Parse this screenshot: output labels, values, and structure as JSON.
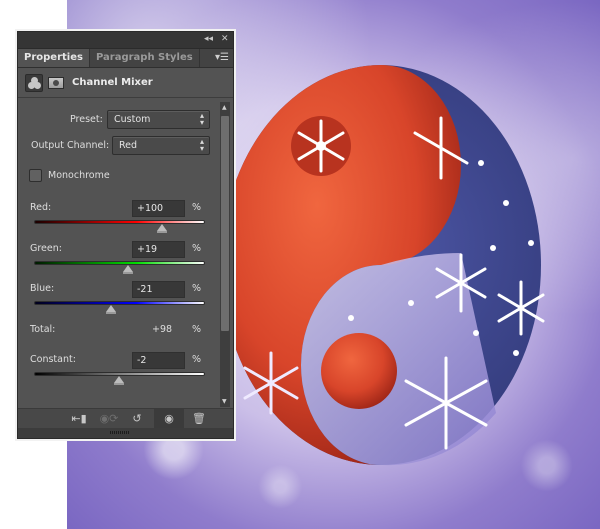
{
  "panel": {
    "topbar": {
      "collapse_icon": "double-chevron-left",
      "close_icon": "close-x"
    },
    "tabs": [
      {
        "label": "Properties",
        "active": true
      },
      {
        "label": "Paragraph Styles",
        "active": false
      }
    ],
    "menu_icon": "panel-menu",
    "adjustment": {
      "title": "Channel Mixer",
      "icons": [
        "channel-mixer-icon",
        "layer-mask-icon"
      ]
    },
    "preset": {
      "label": "Preset:",
      "value": "Custom"
    },
    "output_channel": {
      "label": "Output Channel:",
      "value": "Red"
    },
    "monochrome": {
      "label": "Monochrome",
      "checked": false
    },
    "channels": [
      {
        "label": "Red:",
        "value": "+100",
        "unit": "%",
        "percent": 100,
        "colors": [
          "#1a0000",
          "#ff0000",
          "#ffffff"
        ]
      },
      {
        "label": "Green:",
        "value": "+19",
        "unit": "%",
        "percent": 19,
        "colors": [
          "#001a00",
          "#00dd00",
          "#ffffff"
        ]
      },
      {
        "label": "Blue:",
        "value": "-21",
        "unit": "%",
        "percent": -21,
        "colors": [
          "#00001a",
          "#0000ff",
          "#ffffff"
        ]
      }
    ],
    "total": {
      "label": "Total:",
      "value": "+98",
      "unit": "%"
    },
    "constant": {
      "label": "Constant:",
      "value": "-2",
      "unit": "%",
      "percent": -2
    },
    "slider_range": [
      -200,
      200
    ],
    "bottom_buttons": [
      {
        "name": "clip-to-layer",
        "glyph": "⬚"
      },
      {
        "name": "view-previous-state",
        "glyph": "◎"
      },
      {
        "name": "reset",
        "glyph": "↺"
      },
      {
        "name": "toggle-visibility",
        "glyph": "👁"
      },
      {
        "name": "delete",
        "glyph": "🗑"
      }
    ]
  },
  "colors": {
    "panel_bg": "#535353",
    "rose_red": "#d8452a",
    "night_blue": "#363f7e",
    "lavender": "#8f7ccc"
  }
}
